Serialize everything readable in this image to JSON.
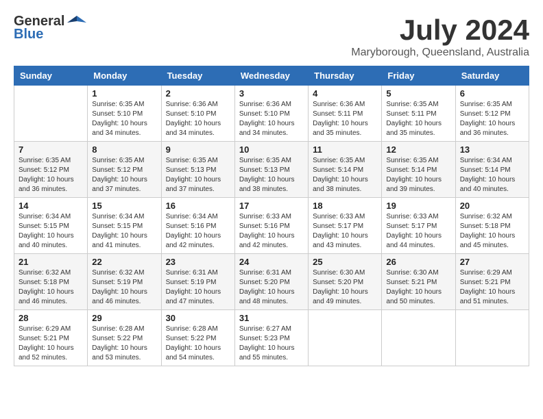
{
  "header": {
    "logo_general": "General",
    "logo_blue": "Blue",
    "main_title": "July 2024",
    "subtitle": "Maryborough, Queensland, Australia"
  },
  "calendar": {
    "days_of_week": [
      "Sunday",
      "Monday",
      "Tuesday",
      "Wednesday",
      "Thursday",
      "Friday",
      "Saturday"
    ],
    "weeks": [
      [
        {
          "day": "",
          "info": ""
        },
        {
          "day": "1",
          "info": "Sunrise: 6:35 AM\nSunset: 5:10 PM\nDaylight: 10 hours\nand 34 minutes."
        },
        {
          "day": "2",
          "info": "Sunrise: 6:36 AM\nSunset: 5:10 PM\nDaylight: 10 hours\nand 34 minutes."
        },
        {
          "day": "3",
          "info": "Sunrise: 6:36 AM\nSunset: 5:10 PM\nDaylight: 10 hours\nand 34 minutes."
        },
        {
          "day": "4",
          "info": "Sunrise: 6:36 AM\nSunset: 5:11 PM\nDaylight: 10 hours\nand 35 minutes."
        },
        {
          "day": "5",
          "info": "Sunrise: 6:35 AM\nSunset: 5:11 PM\nDaylight: 10 hours\nand 35 minutes."
        },
        {
          "day": "6",
          "info": "Sunrise: 6:35 AM\nSunset: 5:12 PM\nDaylight: 10 hours\nand 36 minutes."
        }
      ],
      [
        {
          "day": "7",
          "info": "Sunrise: 6:35 AM\nSunset: 5:12 PM\nDaylight: 10 hours\nand 36 minutes."
        },
        {
          "day": "8",
          "info": "Sunrise: 6:35 AM\nSunset: 5:12 PM\nDaylight: 10 hours\nand 37 minutes."
        },
        {
          "day": "9",
          "info": "Sunrise: 6:35 AM\nSunset: 5:13 PM\nDaylight: 10 hours\nand 37 minutes."
        },
        {
          "day": "10",
          "info": "Sunrise: 6:35 AM\nSunset: 5:13 PM\nDaylight: 10 hours\nand 38 minutes."
        },
        {
          "day": "11",
          "info": "Sunrise: 6:35 AM\nSunset: 5:14 PM\nDaylight: 10 hours\nand 38 minutes."
        },
        {
          "day": "12",
          "info": "Sunrise: 6:35 AM\nSunset: 5:14 PM\nDaylight: 10 hours\nand 39 minutes."
        },
        {
          "day": "13",
          "info": "Sunrise: 6:34 AM\nSunset: 5:14 PM\nDaylight: 10 hours\nand 40 minutes."
        }
      ],
      [
        {
          "day": "14",
          "info": "Sunrise: 6:34 AM\nSunset: 5:15 PM\nDaylight: 10 hours\nand 40 minutes."
        },
        {
          "day": "15",
          "info": "Sunrise: 6:34 AM\nSunset: 5:15 PM\nDaylight: 10 hours\nand 41 minutes."
        },
        {
          "day": "16",
          "info": "Sunrise: 6:34 AM\nSunset: 5:16 PM\nDaylight: 10 hours\nand 42 minutes."
        },
        {
          "day": "17",
          "info": "Sunrise: 6:33 AM\nSunset: 5:16 PM\nDaylight: 10 hours\nand 42 minutes."
        },
        {
          "day": "18",
          "info": "Sunrise: 6:33 AM\nSunset: 5:17 PM\nDaylight: 10 hours\nand 43 minutes."
        },
        {
          "day": "19",
          "info": "Sunrise: 6:33 AM\nSunset: 5:17 PM\nDaylight: 10 hours\nand 44 minutes."
        },
        {
          "day": "20",
          "info": "Sunrise: 6:32 AM\nSunset: 5:18 PM\nDaylight: 10 hours\nand 45 minutes."
        }
      ],
      [
        {
          "day": "21",
          "info": "Sunrise: 6:32 AM\nSunset: 5:18 PM\nDaylight: 10 hours\nand 46 minutes."
        },
        {
          "day": "22",
          "info": "Sunrise: 6:32 AM\nSunset: 5:19 PM\nDaylight: 10 hours\nand 46 minutes."
        },
        {
          "day": "23",
          "info": "Sunrise: 6:31 AM\nSunset: 5:19 PM\nDaylight: 10 hours\nand 47 minutes."
        },
        {
          "day": "24",
          "info": "Sunrise: 6:31 AM\nSunset: 5:20 PM\nDaylight: 10 hours\nand 48 minutes."
        },
        {
          "day": "25",
          "info": "Sunrise: 6:30 AM\nSunset: 5:20 PM\nDaylight: 10 hours\nand 49 minutes."
        },
        {
          "day": "26",
          "info": "Sunrise: 6:30 AM\nSunset: 5:21 PM\nDaylight: 10 hours\nand 50 minutes."
        },
        {
          "day": "27",
          "info": "Sunrise: 6:29 AM\nSunset: 5:21 PM\nDaylight: 10 hours\nand 51 minutes."
        }
      ],
      [
        {
          "day": "28",
          "info": "Sunrise: 6:29 AM\nSunset: 5:21 PM\nDaylight: 10 hours\nand 52 minutes."
        },
        {
          "day": "29",
          "info": "Sunrise: 6:28 AM\nSunset: 5:22 PM\nDaylight: 10 hours\nand 53 minutes."
        },
        {
          "day": "30",
          "info": "Sunrise: 6:28 AM\nSunset: 5:22 PM\nDaylight: 10 hours\nand 54 minutes."
        },
        {
          "day": "31",
          "info": "Sunrise: 6:27 AM\nSunset: 5:23 PM\nDaylight: 10 hours\nand 55 minutes."
        },
        {
          "day": "",
          "info": ""
        },
        {
          "day": "",
          "info": ""
        },
        {
          "day": "",
          "info": ""
        }
      ]
    ]
  }
}
